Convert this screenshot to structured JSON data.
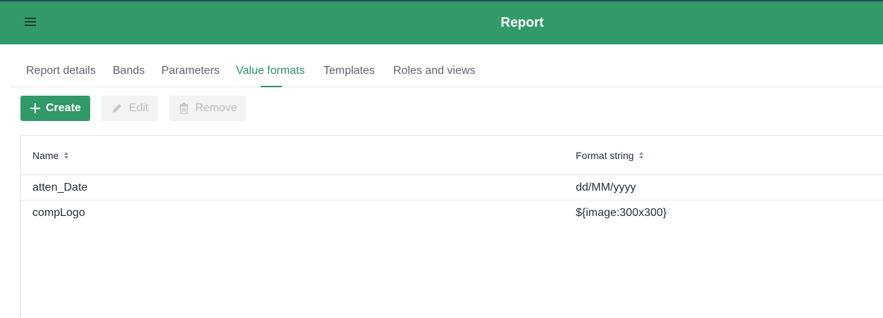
{
  "header": {
    "title": "Report",
    "menu_icon": "hamburger-menu-icon",
    "background": "#319a68"
  },
  "tabs": [
    {
      "label": "Report details",
      "active": false
    },
    {
      "label": "Bands",
      "active": false
    },
    {
      "label": "Parameters",
      "active": false
    },
    {
      "label": "Value formats",
      "active": true
    },
    {
      "label": "Templates",
      "active": false
    },
    {
      "label": "Roles and views",
      "active": false
    }
  ],
  "toolbar": {
    "create_label": "Create",
    "edit_label": "Edit",
    "remove_label": "Remove",
    "create_icon": "plus-icon",
    "edit_icon": "pencil-icon",
    "remove_icon": "trash-icon"
  },
  "table": {
    "columns": [
      "Name",
      "Format string"
    ],
    "rows": [
      [
        "atten_Date",
        "dd/MM/yyyy"
      ],
      [
        "compLogo",
        "${image:300x300}"
      ]
    ]
  },
  "colors": {
    "accent": "#319a68",
    "active_tab": "#2e8f5f",
    "disabled_button": "#f1f3f4"
  }
}
